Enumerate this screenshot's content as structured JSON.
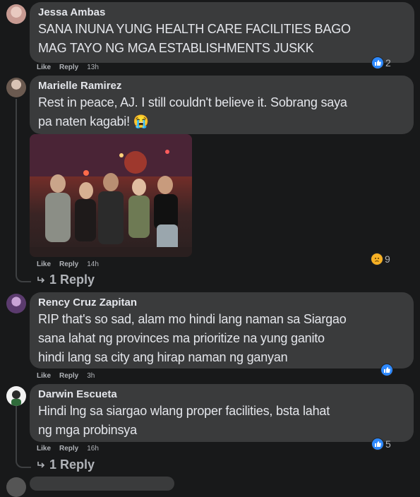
{
  "comments": [
    {
      "author": "Jessa Ambas",
      "text": "SANA INUNA YUNG HEALTH CARE FACILITIES BAGO\nMAG TAYO NG MGA ESTABLISHMENTS JUSKK",
      "like_label": "Like",
      "reply_label": "Reply",
      "time": "13h",
      "reaction_count": "2",
      "reaction_icon": "like-icon"
    },
    {
      "author": "Marielle Ramirez",
      "text": "Rest in peace, AJ. I still couldn't believe it. Sobrang saya\npa naten kagabi! 😭",
      "like_label": "Like",
      "reply_label": "Reply",
      "time": "14h",
      "reaction_count": "9",
      "reaction_icon": "sad-icon",
      "replies_label": "1 Reply"
    },
    {
      "author": "Rency Cruz Zapitan",
      "text": "RIP that's so sad, alam mo hindi lang naman sa Siargao\nsana lahat ng provinces ma prioritize na yung ganito\nhindi lang sa city ang hirap naman ng ganyan",
      "like_label": "Like",
      "reply_label": "Reply",
      "time": "3h",
      "reaction_icon": "like-icon"
    },
    {
      "author": "Darwin Escueta",
      "text": "Hindi lng sa siargao wlang proper facilities, bsta lahat\nng mga probinsya",
      "like_label": "Like",
      "reply_label": "Reply",
      "time": "16h",
      "reaction_count": "5",
      "reaction_icon": "like-icon",
      "replies_label": "1 Reply"
    }
  ],
  "colors": {
    "background": "#18191a",
    "bubble": "#3a3b3c",
    "like_blue": "#2e89ff",
    "sad_yellow": "#f7b125"
  }
}
